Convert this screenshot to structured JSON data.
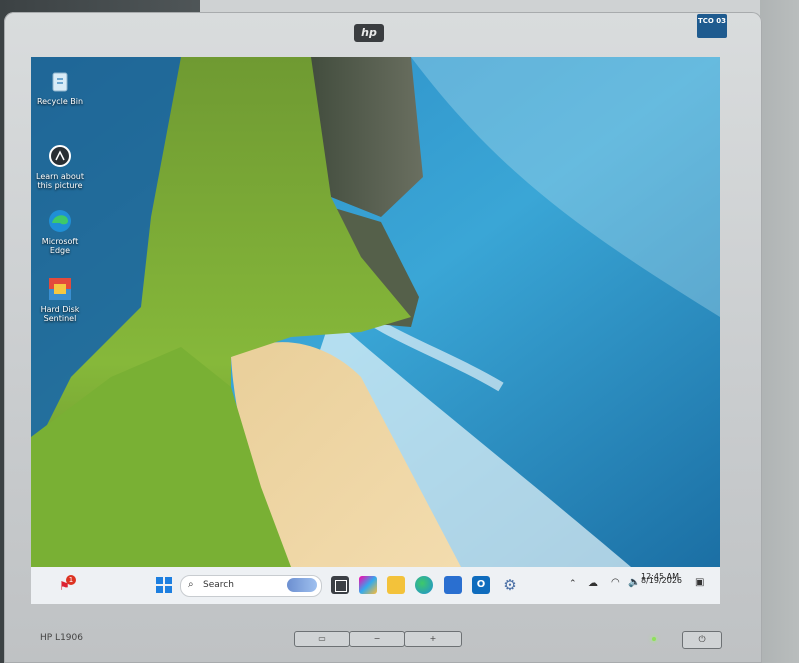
{
  "monitor": {
    "brand_logo": "hp",
    "certification_badge": "TCO 03",
    "model": "HP L1906",
    "osd_buttons": [
      "menu-icon",
      "minus-icon",
      "plus-icon"
    ],
    "power_button_icon": "power-icon",
    "led_color": "#8fe05a"
  },
  "desktop": {
    "icons": [
      {
        "label": "Recycle Bin",
        "icon": "recycle-bin-icon"
      },
      {
        "label": "Learn about this picture",
        "icon": "learn-about-picture-icon"
      },
      {
        "label": "Microsoft Edge",
        "icon": "edge-icon"
      },
      {
        "label": "Hard Disk Sentinel",
        "icon": "hard-disk-sentinel-icon"
      }
    ]
  },
  "taskbar": {
    "notification_badge": "1",
    "search": {
      "placeholder": "Search"
    },
    "pinned_apps": [
      "start-icon",
      "search-icon",
      "widgets-icon",
      "task-view-icon",
      "copilot-icon",
      "file-explorer-icon",
      "edge-icon",
      "store-icon",
      "outlook-icon",
      "settings-icon"
    ],
    "tray": {
      "icons": [
        "chevron-up-icon",
        "onedrive-icon",
        "wifi-icon",
        "volume-icon"
      ],
      "time": "12:45 AM",
      "date": "8/19/2026"
    }
  }
}
